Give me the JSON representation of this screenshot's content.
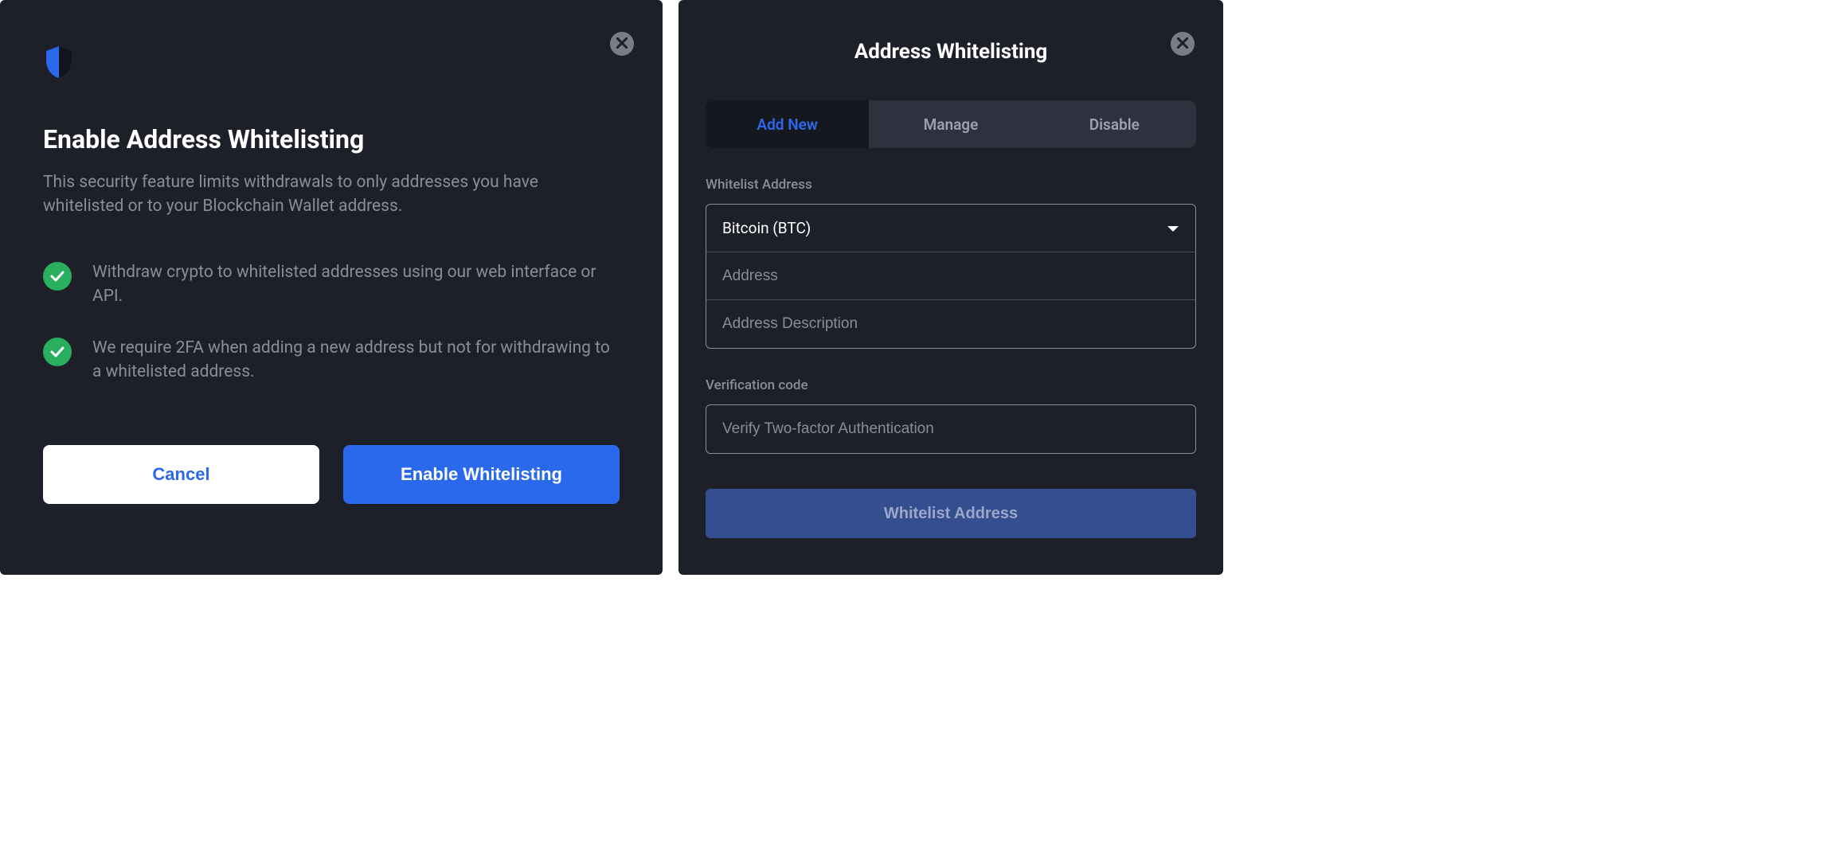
{
  "leftPanel": {
    "title": "Enable Address Whitelisting",
    "description": "This security feature limits withdrawals to only addresses you have whitelisted or to your Blockchain Wallet address.",
    "features": [
      "Withdraw crypto to whitelisted addresses using our web interface or API.",
      "We require 2FA when adding a new address but not for withdrawing to a whitelisted address."
    ],
    "cancel": "Cancel",
    "enable": "Enable Whitelisting"
  },
  "rightPanel": {
    "title": "Address Whitelisting",
    "tabs": [
      "Add New",
      "Manage",
      "Disable"
    ],
    "activeTab": 0,
    "whitelistLabel": "Whitelist Address",
    "coinSelected": "Bitcoin (BTC)",
    "addressPlaceholder": "Address",
    "descriptionPlaceholder": "Address Description",
    "verificationLabel": "Verification code",
    "verificationPlaceholder": "Verify Two-factor Authentication",
    "submit": "Whitelist Address"
  }
}
